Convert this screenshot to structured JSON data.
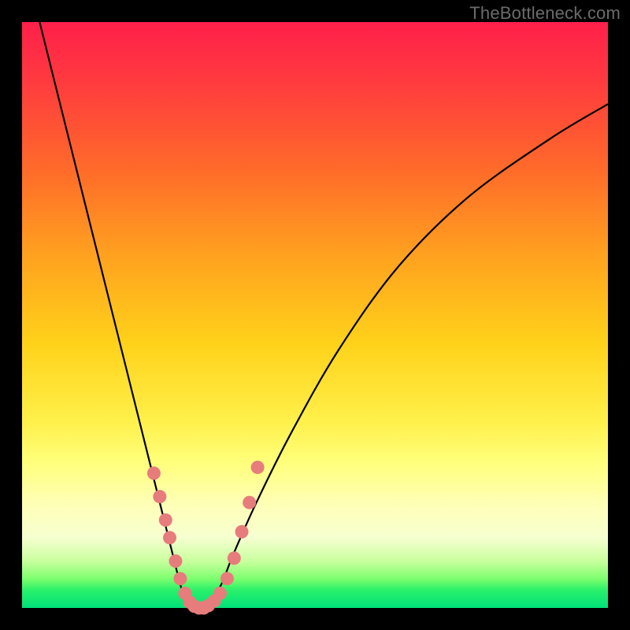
{
  "watermark": "TheBottleneck.com",
  "chart_data": {
    "type": "line",
    "title": "",
    "xlabel": "",
    "ylabel": "",
    "xlim": [
      0,
      100
    ],
    "ylim": [
      0,
      100
    ],
    "grid": false,
    "series": [
      {
        "name": "curve",
        "x": [
          3,
          6,
          10,
          14,
          18,
          22,
          24,
          26,
          27,
          28,
          29,
          30,
          31,
          32,
          34,
          36,
          40,
          46,
          54,
          64,
          76,
          90,
          100
        ],
        "y": [
          100,
          88,
          72,
          56,
          40,
          24,
          16,
          8,
          4,
          1,
          0,
          0,
          0,
          1,
          4,
          9,
          18,
          30,
          44,
          58,
          70,
          80,
          86
        ]
      }
    ],
    "marker_points": {
      "comment": "salmon dots along the curve near the trough",
      "x": [
        22.5,
        23.5,
        24.5,
        25.2,
        26.2,
        27,
        27.8,
        28.6,
        29.4,
        30.2,
        31,
        31.8,
        32.8,
        33.8,
        35,
        36.2,
        37.5,
        38.8,
        40.2
      ],
      "y": [
        23,
        19,
        15,
        12,
        8,
        5,
        2.5,
        1,
        0.3,
        0,
        0,
        0.4,
        1.2,
        2.5,
        5,
        8.5,
        13,
        18,
        24
      ]
    },
    "marker_color": "#e77c7c",
    "curve_color": "#000000",
    "gradient_stops": [
      {
        "pos": 0.0,
        "color": "#ff1f4a"
      },
      {
        "pos": 0.55,
        "color": "#ffd21a"
      },
      {
        "pos": 0.82,
        "color": "#ffffb5"
      },
      {
        "pos": 1.0,
        "color": "#00e27a"
      }
    ]
  }
}
